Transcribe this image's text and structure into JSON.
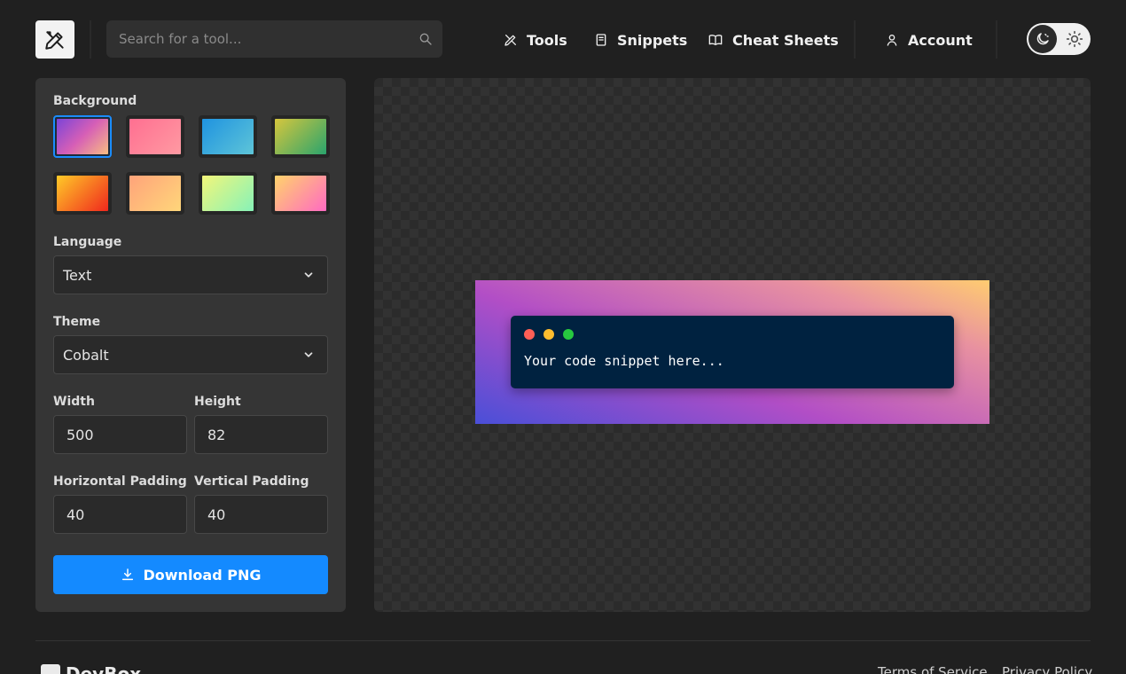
{
  "header": {
    "search_placeholder": "Search for a tool...",
    "nav": [
      {
        "label": "Tools",
        "icon": "tools-icon"
      },
      {
        "label": "Snippets",
        "icon": "snippet-icon"
      },
      {
        "label": "Cheat Sheets",
        "icon": "book-icon"
      }
    ],
    "account_label": "Account",
    "theme_toggle": {
      "active": "dark",
      "options": [
        "dark",
        "light"
      ]
    }
  },
  "panel": {
    "background_label": "Background",
    "backgrounds": [
      {
        "from": "#7c44d8",
        "via": "#d65fb6",
        "to": "#f8bd82",
        "selected": true
      },
      {
        "from": "#ff6f91",
        "to": "#ff9aa2",
        "selected": false
      },
      {
        "from": "#1f93e0",
        "to": "#5ec5d8",
        "selected": false
      },
      {
        "from": "#d6c63d",
        "to": "#2aa46d",
        "selected": false
      },
      {
        "from": "#ffca28",
        "to": "#f0281d",
        "selected": false
      },
      {
        "from": "#ffa37a",
        "to": "#ffd67a",
        "selected": false
      },
      {
        "from": "#f2f67a",
        "to": "#86f2b8",
        "selected": false
      },
      {
        "from": "#ffd36b",
        "to": "#ff6ac2",
        "selected": false
      }
    ],
    "language_label": "Language",
    "language_value": "Text",
    "theme_label": "Theme",
    "theme_value": "Cobalt",
    "width_label": "Width",
    "width_value": "500",
    "height_label": "Height",
    "height_value": "82",
    "hpad_label": "Horizontal Padding",
    "hpad_value": "40",
    "vpad_label": "Vertical Padding",
    "vpad_value": "40",
    "download_label": "Download PNG"
  },
  "preview": {
    "code": "Your code snippet here...",
    "window_dots": [
      "#ff5f56",
      "#ffbd2e",
      "#27c93f"
    ],
    "code_background": "#002240"
  },
  "footer": {
    "brand": "DevBox",
    "links": [
      "Terms of Service",
      "Privacy Policy"
    ]
  },
  "colors": {
    "accent": "#148aff",
    "page_bg": "#202020",
    "panel_bg": "#353535"
  }
}
